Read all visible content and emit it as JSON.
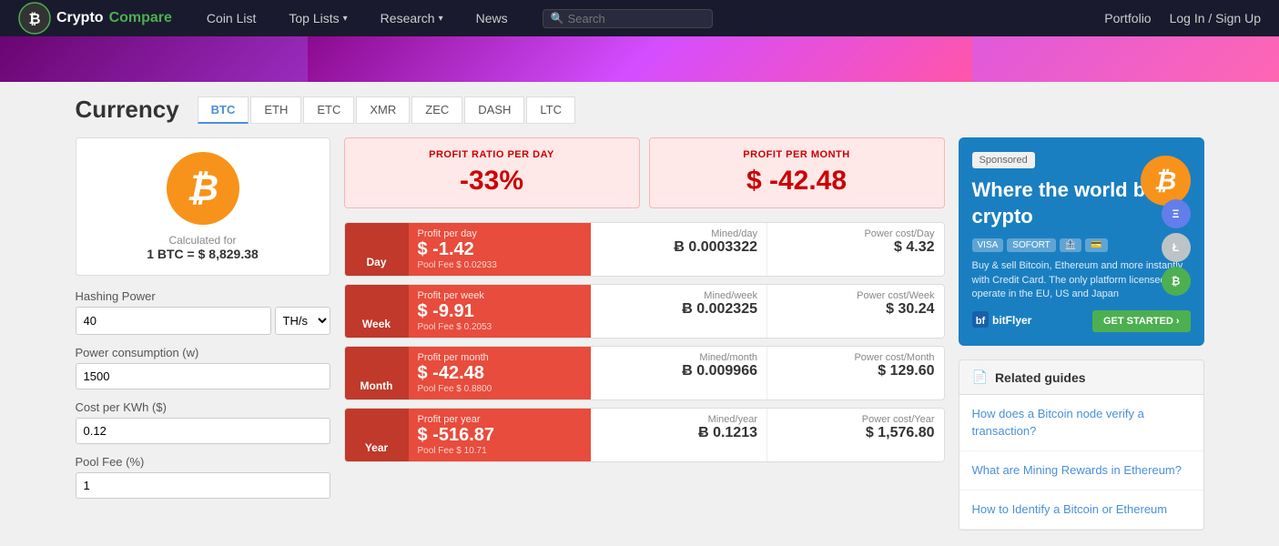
{
  "navbar": {
    "brand": {
      "name_crypto": "Crypto",
      "name_compare": "Compare"
    },
    "links": [
      {
        "label": "Coin List",
        "has_dropdown": false
      },
      {
        "label": "Top Lists",
        "has_dropdown": true
      },
      {
        "label": "Research",
        "has_dropdown": true
      },
      {
        "label": "News",
        "has_dropdown": false
      }
    ],
    "search_placeholder": "Search",
    "portfolio_label": "Portfolio",
    "login_label": "Log In / Sign Up"
  },
  "currency": {
    "title": "Currency",
    "tabs": [
      {
        "label": "BTC",
        "active": true
      },
      {
        "label": "ETH",
        "active": false
      },
      {
        "label": "ETC",
        "active": false
      },
      {
        "label": "XMR",
        "active": false
      },
      {
        "label": "ZEC",
        "active": false
      },
      {
        "label": "DASH",
        "active": false
      },
      {
        "label": "LTC",
        "active": false
      }
    ]
  },
  "coin": {
    "symbol": "₿",
    "calc_label": "Calculated for",
    "calc_value": "1 BTC = $ 8,829.38"
  },
  "inputs": {
    "hashing_power": {
      "label": "Hashing Power",
      "value": "40",
      "unit": "TH/s"
    },
    "power_consumption": {
      "label": "Power consumption (w)",
      "value": "1500"
    },
    "cost_per_kwh": {
      "label": "Cost per KWh ($)",
      "value": "0.12"
    },
    "pool_fee": {
      "label": "Pool Fee (%)",
      "value": "1"
    }
  },
  "profit_summary": {
    "ratio_label": "PROFIT RATIO PER DAY",
    "ratio_value": "-33%",
    "month_label": "PROFIT PER MONTH",
    "month_value": "$ -42.48"
  },
  "rows": [
    {
      "period": "Day",
      "profit_label": "Profit per day",
      "profit_value": "$ -1.42",
      "pool_fee": "Pool Fee $ 0.02933",
      "mined_label": "Mined/day",
      "mined_value": "Ƀ 0.0003322",
      "power_label": "Power cost/Day",
      "power_value": "$ 4.32"
    },
    {
      "period": "Week",
      "profit_label": "Profit per week",
      "profit_value": "$ -9.91",
      "pool_fee": "Pool Fee $ 0.2053",
      "mined_label": "Mined/week",
      "mined_value": "Ƀ 0.002325",
      "power_label": "Power cost/Week",
      "power_value": "$ 30.24"
    },
    {
      "period": "Month",
      "profit_label": "Profit per month",
      "profit_value": "$ -42.48",
      "pool_fee": "Pool Fee $ 0.8800",
      "mined_label": "Mined/month",
      "mined_value": "Ƀ 0.009966",
      "power_label": "Power cost/Month",
      "power_value": "$ 129.60"
    },
    {
      "period": "Year",
      "profit_label": "Profit per year",
      "profit_value": "$ -516.87",
      "pool_fee": "Pool Fee $ 10.71",
      "mined_label": "Mined/year",
      "mined_value": "Ƀ 0.1213",
      "power_label": "Power cost/Year",
      "power_value": "$ 1,576.80"
    }
  ],
  "ad": {
    "sponsored_label": "Sponsored",
    "title": "Where the world buys crypto",
    "description": "Buy & sell Bitcoin, Ethereum and more instantly with Credit Card. The only platform licensed to operate in the EU, US and Japan",
    "payment_icons": [
      "VISA",
      "SOFORT",
      "🏦",
      "💳"
    ],
    "logo": "bitFlyer",
    "cta": "GET STARTED ›"
  },
  "related_guides": {
    "title": "Related guides",
    "links": [
      "How does a Bitcoin node verify a transaction?",
      "What are Mining Rewards in Ethereum?",
      "How to Identify a Bitcoin or Ethereum"
    ]
  }
}
